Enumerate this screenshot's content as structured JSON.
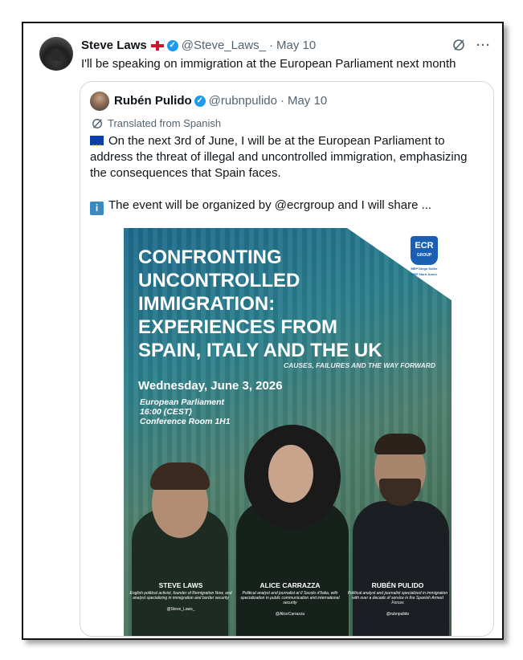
{
  "tweet": {
    "author_name": "Steve Laws",
    "flag_emoji": "england-flag",
    "handle": "@Steve_Laws_",
    "separator": "·",
    "date": "May 10",
    "text": "I'll be speaking on immigration at the European Parliament next month",
    "icons": [
      "grok-icon",
      "more-icon"
    ]
  },
  "quoted": {
    "author_name": "Rubén Pulido",
    "handle": "@rubnpulido",
    "separator": "·",
    "date": "May 10",
    "translated_label": "Translated from Spanish",
    "paragraph1": "On the next 3rd of June, I will be at the European Parliament to address the threat of illegal and uncontrolled immigration, emphasizing the consequences that Spain faces.",
    "paragraph2": "The event will be organized by @ecrgroup and I will share ..."
  },
  "poster": {
    "title_lines": [
      "CONFRONTING",
      "UNCONTROLLED",
      "IMMIGRATION:",
      "EXPERIENCES FROM",
      "SPAIN, ITALY AND THE UK"
    ],
    "subtitle": "CAUSES, FAILURES AND THE WAY FORWARD",
    "date": "Wednesday, June 3, 2026",
    "place_lines": [
      "European Parliament",
      "16:00 (CEST)",
      "Conference Room 1H1"
    ],
    "logo_text": "ECR",
    "logo_sub": "GROUP",
    "mep_lines": [
      "MEP Diego Solier",
      "MEP Nora Junco"
    ],
    "speakers": [
      {
        "name": "STEVE LAWS",
        "desc": "English political activist, founder of Remigration Now, and analyst specializing in immigration and border security",
        "handle": "@Steve_Laws_"
      },
      {
        "name": "ALICE CARRAZZA",
        "desc": "Political analyst and journalist at Il Secolo d'Italia, with specialization in public communication and international security",
        "handle": "@AliceCarrazza"
      },
      {
        "name": "RUBÉN PULIDO",
        "desc": "Political analyst and journalist specialized in immigration with over a decade of service in the Spanish Armed Forces",
        "handle": "@rubnpulido"
      }
    ]
  }
}
